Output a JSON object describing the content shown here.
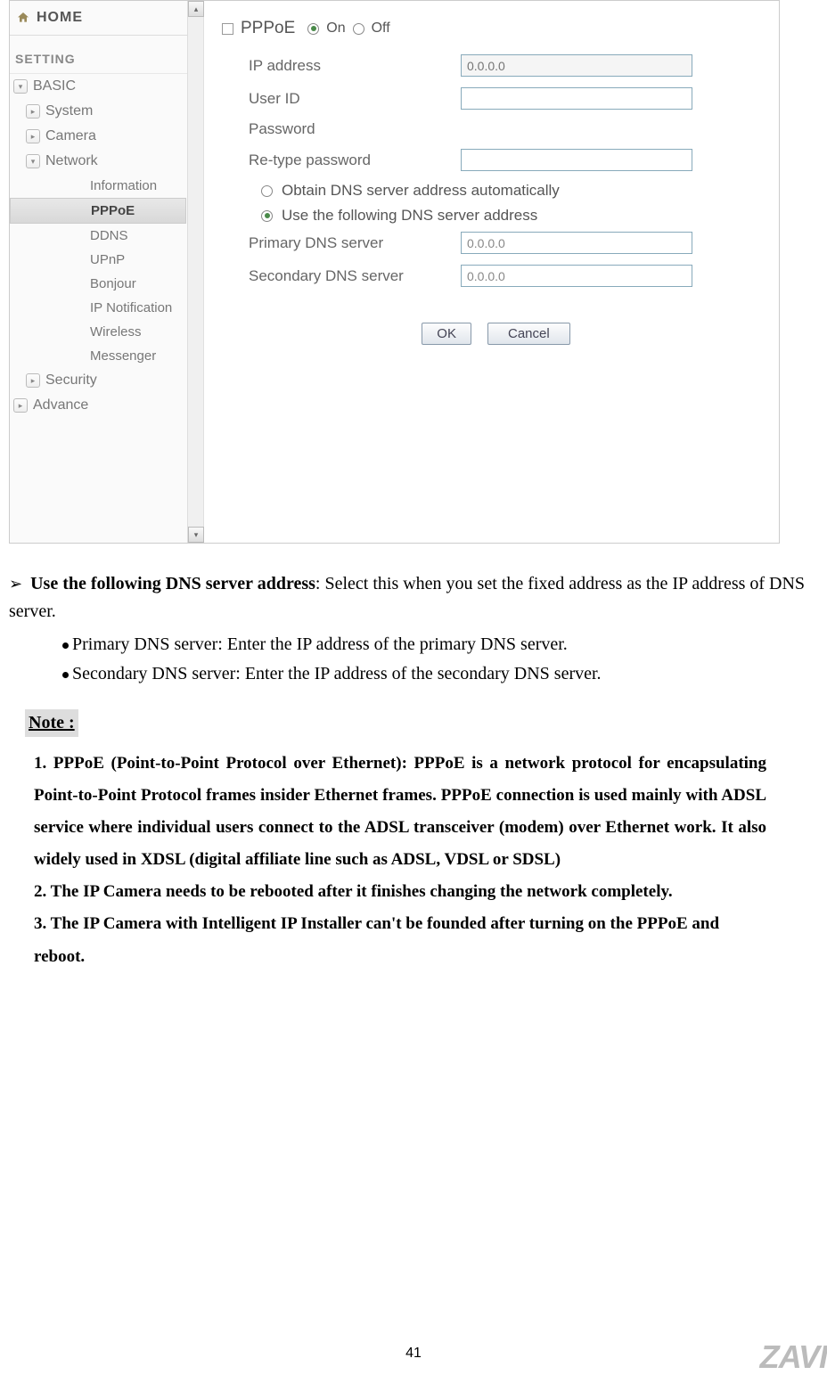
{
  "sidebar": {
    "home": "HOME",
    "section": "SETTING",
    "basic": "BASIC",
    "system": "System",
    "camera": "Camera",
    "network": "Network",
    "network_children": {
      "information": "Information",
      "pppoe": "PPPoE",
      "ddns": "DDNS",
      "upnp": "UPnP",
      "bonjour": "Bonjour",
      "ipnotif": "IP Notification",
      "wireless": "Wireless",
      "messenger": "Messenger"
    },
    "security": "Security",
    "advance": "Advance"
  },
  "form": {
    "pppoe_label": "PPPoE",
    "on": "On",
    "off": "Off",
    "ip_address": "IP address",
    "ip_placeholder": "0.0.0.0",
    "user_id": "User ID",
    "password": "Password",
    "retype_password": "Re-type password",
    "dns_auto": "Obtain DNS server address automatically",
    "dns_manual": "Use the following DNS server address",
    "primary_dns": "Primary DNS server",
    "secondary_dns": "Secondary DNS server",
    "primary_val": "0.0.0.0",
    "secondary_val": "0.0.0.0",
    "ok": "OK",
    "cancel": "Cancel"
  },
  "doc": {
    "heading_bold": "Use the following DNS server address",
    "heading_rest": ": Select this when you set the fixed address as the IP address of DNS server.",
    "bullet1": "Primary DNS server: Enter the IP address of the primary DNS server.",
    "bullet2": "Secondary DNS server: Enter the IP address of the secondary DNS server.",
    "note_label": "Note :",
    "note1": "1. PPPoE (Point-to-Point Protocol over Ethernet): PPPoE is a network protocol for encapsulating Point-to-Point Protocol frames insider Ethernet frames. PPPoE connection is used mainly with ADSL service where individual users connect to the ADSL transceiver (modem) over Ethernet work. It also widely used in XDSL (digital affiliate line such as ADSL, VDSL or SDSL)",
    "note2": "2. The IP Camera needs to be rebooted after it finishes changing the network completely.",
    "note3": "3. The IP Camera with Intelligent IP Installer can't be founded after turning on the PPPoE and reboot."
  },
  "page_number": "41",
  "brand": "ZAVI"
}
